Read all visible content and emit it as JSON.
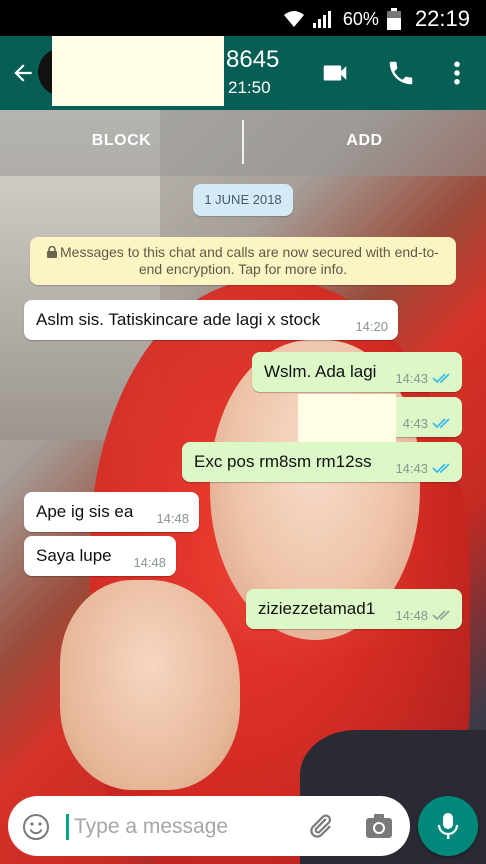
{
  "status": {
    "wifi_icon": "wifi-icon",
    "signal_icon": "signal-icon",
    "battery": "60%",
    "time": "22:19"
  },
  "header": {
    "name": "8645",
    "subtitle": "21:50",
    "back_icon": "back-arrow-icon",
    "video_icon": "video-call-icon",
    "call_icon": "phone-icon",
    "menu_icon": "more-vert-icon"
  },
  "actions": {
    "block": "BLOCK",
    "add": "ADD"
  },
  "date_chip": "1 JUNE 2018",
  "notice": {
    "line1": "Messages to this chat and calls are now secured with end-to-",
    "line2": "end encryption. Tap for more info."
  },
  "messages": [
    {
      "dir": "in",
      "text": "Aslm sis. Tatiskincare ade lagi x stock",
      "time": "14:20"
    },
    {
      "dir": "out",
      "text": "Wslm. Ada lagi",
      "time": "14:43",
      "status": "read"
    },
    {
      "dir": "out",
      "text": "",
      "time": "4:43",
      "status": "read"
    },
    {
      "dir": "out",
      "text": "Exc pos rm8sm rm12ss",
      "time": "14:43",
      "status": "read"
    },
    {
      "dir": "in",
      "text": "Ape ig sis ea",
      "time": "14:48"
    },
    {
      "dir": "in",
      "text": "Saya lupe",
      "time": "14:48"
    },
    {
      "dir": "out",
      "text": "ziziezzetamad1",
      "time": "14:48",
      "status": "delivered"
    }
  ],
  "input": {
    "placeholder": "Type a message"
  },
  "colors": {
    "header": "#075e54",
    "outgoing_bubble": "#dcf8c6",
    "incoming_bubble": "#ffffff",
    "read_tick": "#34b7f1",
    "fab": "#00897b"
  }
}
